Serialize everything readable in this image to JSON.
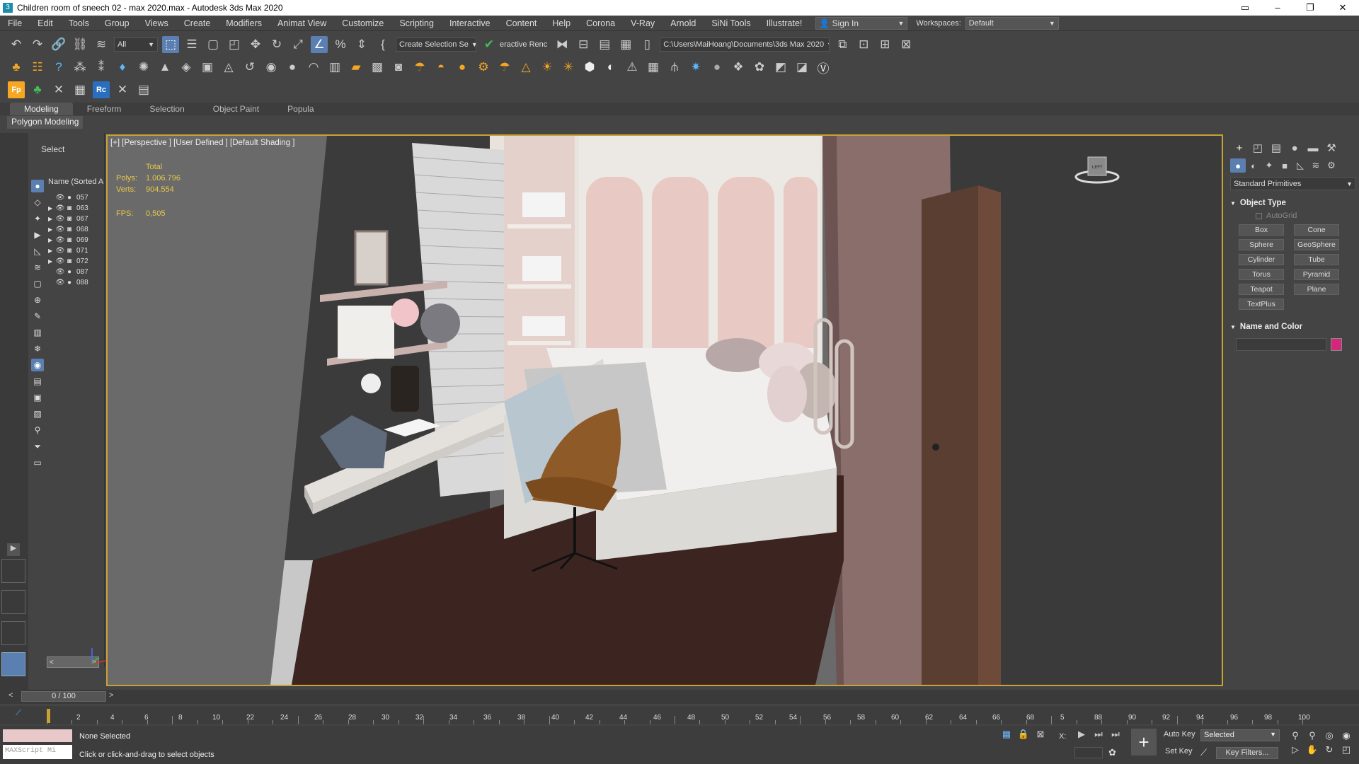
{
  "window": {
    "title": "Children room of sneech 02 - max 2020.max - Autodesk 3ds Max 2020"
  },
  "menu": [
    "File",
    "Edit",
    "Tools",
    "Group",
    "Views",
    "Create",
    "Modifiers",
    "Animat View",
    "Customize",
    "Scripting",
    "Interactive",
    "Content",
    "Help",
    "Corona",
    "V-Ray",
    "Arnold",
    "SiNi Tools",
    "Illustrate!"
  ],
  "account": {
    "sign_in": "Sign In",
    "workspaces_label": "Workspaces:",
    "workspace": "Default"
  },
  "toolbar": {
    "filter": "All",
    "selection_set": "Create Selection Se",
    "interactive_render": "eractive Renc",
    "project_path": "C:\\Users\\MaiHoang\\Documents\\3ds Max 2020"
  },
  "ribbon": {
    "tabs": [
      "Modeling",
      "Freeform",
      "Selection",
      "Object Paint",
      "Popula"
    ],
    "active_panel": "Polygon Modeling"
  },
  "scene_explorer": {
    "header": "Select",
    "column": "Name (Sorted A",
    "objects": [
      {
        "name": "057",
        "expandable": false
      },
      {
        "name": "063",
        "expandable": true
      },
      {
        "name": "067",
        "expandable": true
      },
      {
        "name": "068",
        "expandable": true
      },
      {
        "name": "069",
        "expandable": true
      },
      {
        "name": "071",
        "expandable": true
      },
      {
        "name": "072",
        "expandable": true
      },
      {
        "name": "087",
        "expandable": false
      },
      {
        "name": "088",
        "expandable": false
      }
    ]
  },
  "viewport": {
    "label": "[+] [Perspective ] [User Defined ] [Default Shading ]",
    "stats": {
      "header": "Total",
      "polys_label": "Polys:",
      "polys": "1.006.796",
      "verts_label": "Verts:",
      "verts": "904.554",
      "fps_label": "FPS:",
      "fps": "0,505"
    },
    "viewcube_label": "LEFT"
  },
  "command_panel": {
    "category": "Standard Primitives",
    "object_type_title": "Object Type",
    "autogrid": "AutoGrid",
    "primitives": [
      "Box",
      "Cone",
      "Sphere",
      "GeoSphere",
      "Cylinder",
      "Tube",
      "Torus",
      "Pyramid",
      "Teapot",
      "Plane",
      "TextPlus"
    ],
    "name_color_title": "Name and Color",
    "object_color": "#d4267a"
  },
  "timeline": {
    "slider": "0 / 100",
    "ticks": [
      "2",
      "4",
      "6",
      "8",
      "10",
      "22",
      "24",
      "26",
      "28",
      "30",
      "32",
      "34",
      "36",
      "38",
      "40",
      "42",
      "44",
      "46",
      "48",
      "50",
      "52",
      "54",
      "56",
      "58",
      "60",
      "62",
      "64",
      "66",
      "68",
      "5",
      "88",
      "90",
      "92",
      "94",
      "96",
      "98",
      "100"
    ]
  },
  "status": {
    "selection": "None Selected",
    "hint": "Click or click-and-drag to select objects",
    "maxscript": "MAXScript Mi",
    "x_label": "X:",
    "auto_key": "Auto Key",
    "set_key": "Set Key",
    "key_mode": "Selected",
    "key_filters": "Key Filters..."
  }
}
